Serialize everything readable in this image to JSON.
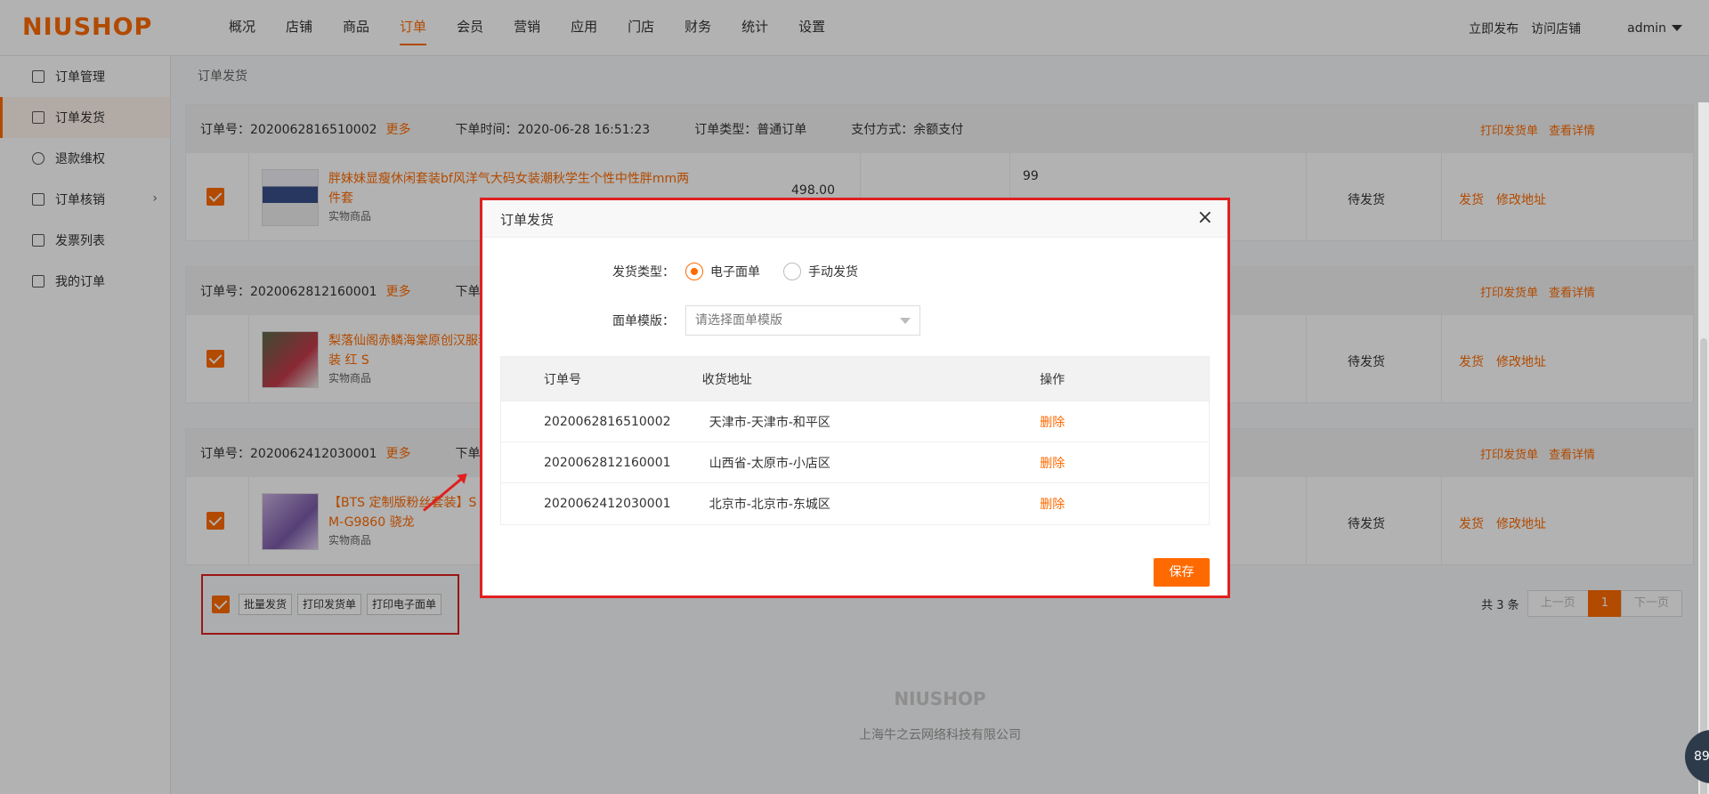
{
  "topbar": {
    "logo": "NIUSHOP",
    "nav": [
      "概况",
      "店铺",
      "商品",
      "订单",
      "会员",
      "营销",
      "应用",
      "门店",
      "财务",
      "统计",
      "设置"
    ],
    "active_nav": "订单",
    "publish": "立即发布",
    "visit": "访问店铺",
    "user": "admin"
  },
  "sidebar": {
    "items": [
      {
        "label": "订单管理",
        "icon": "document-list-icon"
      },
      {
        "label": "订单发货",
        "icon": "shipping-icon"
      },
      {
        "label": "退款维权",
        "icon": "refund-icon"
      },
      {
        "label": "订单核销",
        "icon": "verify-icon"
      },
      {
        "label": "发票列表",
        "icon": "invoice-icon"
      },
      {
        "label": "我的订单",
        "icon": "my-order-icon"
      }
    ],
    "expand_glyph": "›"
  },
  "breadcrumb": "订单发货",
  "orders": [
    {
      "no_label": "订单号：2020062816510002",
      "more": "更多",
      "time": "下单时间：2020-06-28 16:51:23",
      "type": "订单类型：普通订单",
      "pay": "支付方式：余额支付",
      "print": "打印发货单",
      "detail": "查看详情",
      "goods_name": "胖妹妹显瘦休闲套装bf风洋气大码女装潮秋学生个性中性胖mm两件套",
      "goods_type": "实物商品",
      "price": "498.00",
      "qty": "99",
      "status": "待发货",
      "op1": "发货",
      "op2": "修改地址"
    },
    {
      "no_label": "订单号：2020062812160001",
      "more": "更多",
      "time": "下单",
      "print": "打印发货单",
      "detail": "查看详情",
      "goods_name": "梨落仙阁赤鳞海棠原创汉服套装 红 S",
      "goods_type": "实物商品",
      "status": "待发货",
      "op1": "发货",
      "op2": "修改地址"
    },
    {
      "no_label": "订单号：2020062412030001",
      "more": "更多",
      "time": "下单",
      "print": "打印发货单",
      "detail": "查看详情",
      "goods_name": "【BTS 定制版粉丝套装】S M-G9860 骁龙",
      "goods_type": "实物商品",
      "status": "待发货",
      "op1": "发货",
      "op2": "修改地址"
    }
  ],
  "batch": {
    "b1": "批量发货",
    "b2": "打印发货单",
    "b3": "打印电子面单"
  },
  "pager": {
    "total": "共 3 条",
    "prev": "上一页",
    "current": "1",
    "next": "下一页"
  },
  "footer": {
    "logo": "NIUSHOP",
    "company": "上海牛之云网络科技有限公司"
  },
  "modal": {
    "title": "订单发货",
    "close": "×",
    "ship_type_label": "发货类型：",
    "opt_electronic": "电子面单",
    "opt_manual": "手动发货",
    "template_label": "面单模版：",
    "template_placeholder": "请选择面单模版",
    "table_headers": [
      "订单号",
      "收货地址",
      "操作"
    ],
    "rows": [
      {
        "no": "2020062816510002",
        "addr": "天津市-天津市-和平区",
        "op": "删除"
      },
      {
        "no": "2020062812160001",
        "addr": "山西省-太原市-小店区",
        "op": "删除"
      },
      {
        "no": "2020062412030001",
        "addr": "北京市-北京市-东城区",
        "op": "删除"
      }
    ],
    "save": "保存"
  },
  "chat_badge": "89",
  "colors": {
    "accent": "#ff6a00",
    "highlight": "#e02020"
  }
}
